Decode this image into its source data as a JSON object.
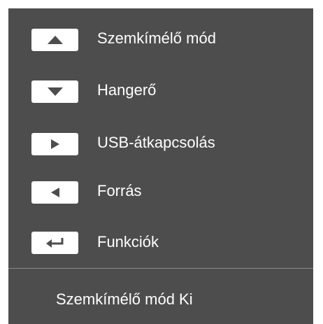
{
  "menu": {
    "items": [
      {
        "icon": "arrow-up-icon",
        "label": "Szemkímélő mód"
      },
      {
        "icon": "arrow-down-icon",
        "label": "Hangerő"
      },
      {
        "icon": "arrow-right-icon",
        "label": "USB-átkapcsolás"
      },
      {
        "icon": "arrow-left-icon",
        "label": "Forrás"
      },
      {
        "icon": "enter-return-icon",
        "label": "Funkciók"
      }
    ]
  },
  "status": {
    "text": "Szemkímélő mód Ki"
  },
  "colors": {
    "panel_background": "#4d4d4d",
    "key_background": "#ffffff",
    "key_glyph": "#4d4d4d",
    "text": "#ffffff",
    "divider": "#8a8a8a"
  }
}
